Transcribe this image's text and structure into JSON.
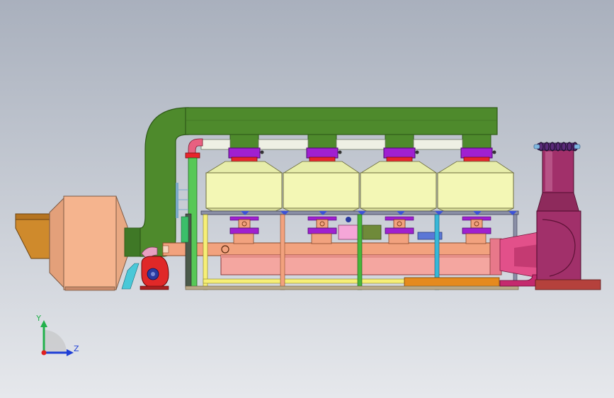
{
  "viewport": {
    "background_top": "#a9b0bd",
    "background_bottom": "#e6e8ec"
  },
  "triad": {
    "y_label": "Y",
    "z_label": "Z",
    "y_color": "#22b14c",
    "z_color": "#1f3fd6",
    "origin_color": "#e02020"
  },
  "colors": {
    "duct_green": "#4e8a2c",
    "duct_green_dark": "#2f5a18",
    "adsorber_body": "#f3f7b5",
    "adsorber_outline": "#6d6d3c",
    "valve_purple": "#a020d0",
    "valve_red": "#e8242c",
    "catalytic_pink": "#f4a6a0",
    "header_salmon": "#f2a27e",
    "filter_peach": "#f5b48e",
    "inlet_orange": "#cf8a2c",
    "chimney_magenta": "#a1306a",
    "fan_blower_red": "#e02828",
    "support_yellow": "#f7ef77",
    "support_green": "#47b53a",
    "support_cyan": "#37b7d8",
    "platform_orange": "#e58a1e",
    "frame_gray": "#8a8fa6",
    "steel_blue": "#3c52d8"
  },
  "components": {
    "adsorber_count": 4,
    "valve_count": 4
  }
}
